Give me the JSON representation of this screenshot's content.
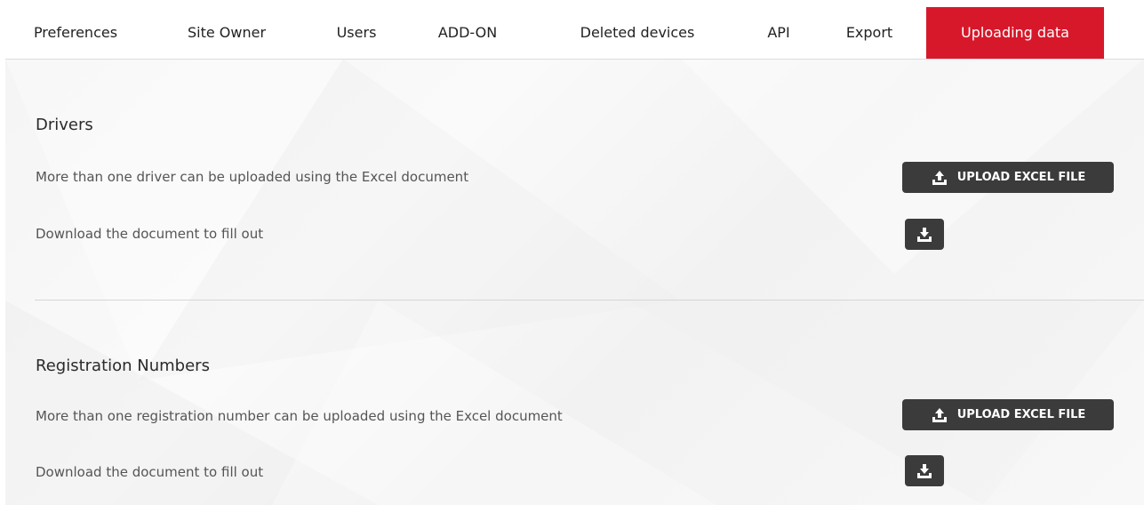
{
  "tabs": [
    {
      "label": "Preferences",
      "active": false
    },
    {
      "label": "Site Owner",
      "active": false
    },
    {
      "label": "Users",
      "active": false
    },
    {
      "label": "ADD-ON",
      "active": false
    },
    {
      "label": "Deleted devices",
      "active": false
    },
    {
      "label": "API",
      "active": false
    },
    {
      "label": "Export",
      "active": false
    },
    {
      "label": "Uploading data",
      "active": true
    }
  ],
  "sections": {
    "drivers": {
      "title": "Drivers",
      "upload_description": "More than one driver can be uploaded using the Excel document",
      "upload_button_label": "UPLOAD EXCEL FILE",
      "upload_icon": "upload-icon",
      "download_description": "Download the document to fill out",
      "download_icon": "download-icon"
    },
    "registration": {
      "title": "Registration Numbers",
      "upload_description": "More than one registration number can be uploaded using the Excel document",
      "upload_button_label": "UPLOAD EXCEL FILE",
      "upload_icon": "upload-icon",
      "download_description": "Download the document to fill out",
      "download_icon": "download-icon"
    }
  },
  "colors": {
    "accent": "#d7182a",
    "button_bg": "#3b3b3b",
    "button_text": "#ffffff"
  }
}
